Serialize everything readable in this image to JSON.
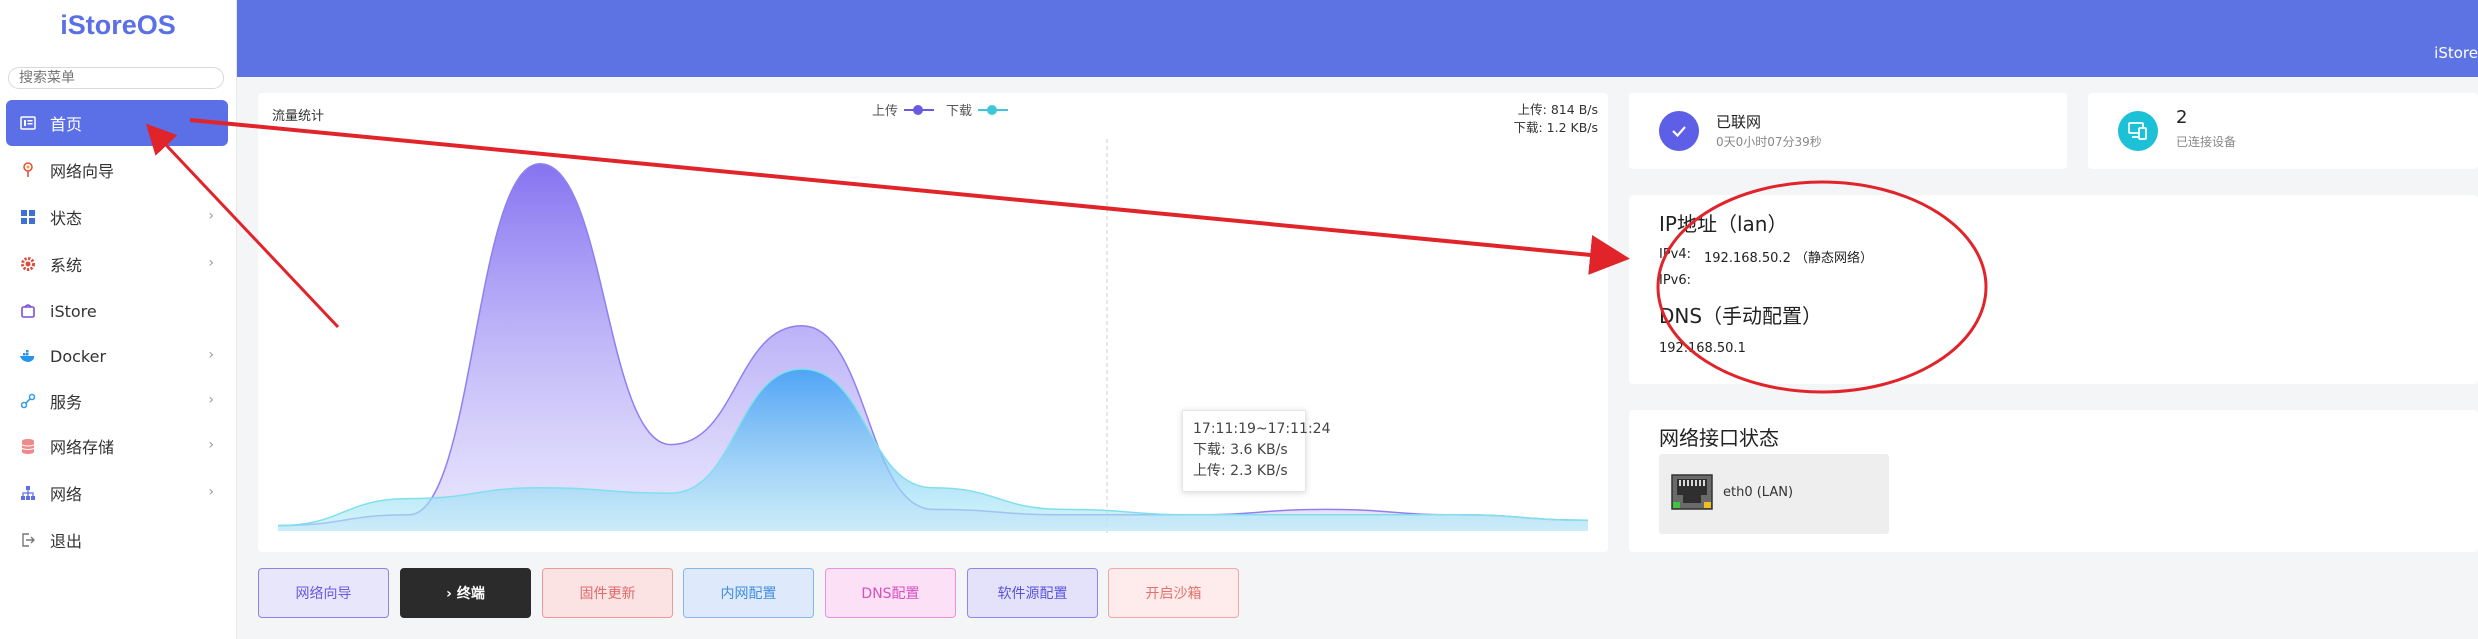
{
  "app": {
    "logo": "iStoreOS",
    "header_brand": "iStore"
  },
  "search": {
    "placeholder": "搜索菜单"
  },
  "menu": [
    {
      "label": "首页",
      "icon": "home-icon",
      "active": true
    },
    {
      "label": "网络向导",
      "icon": "wizard-icon"
    },
    {
      "label": "状态",
      "icon": "status-icon",
      "chevron": true
    },
    {
      "label": "系统",
      "icon": "gear-icon",
      "chevron": true
    },
    {
      "label": "iStore",
      "icon": "store-icon"
    },
    {
      "label": "Docker",
      "icon": "docker-icon",
      "chevron": true
    },
    {
      "label": "服务",
      "icon": "services-icon",
      "chevron": true
    },
    {
      "label": "网络存储",
      "icon": "storage-icon",
      "chevron": true
    },
    {
      "label": "网络",
      "icon": "network-icon",
      "chevron": true
    },
    {
      "label": "退出",
      "icon": "logout-icon"
    }
  ],
  "traffic": {
    "title": "流量统计",
    "legend": [
      {
        "label": "上传",
        "color": "#6a5ae0"
      },
      {
        "label": "下载",
        "color": "#3fc6dc"
      }
    ],
    "upload_rate": "上传: 814 B/s",
    "download_rate": "下载: 1.2 KB/s",
    "tooltip": {
      "time": "17:11:19~17:11:24",
      "download": "下载: 3.6 KB/s",
      "upload": "上传: 2.3 KB/s"
    }
  },
  "chart_data": {
    "type": "area",
    "title": "流量统计",
    "series": [
      {
        "name": "上传",
        "values": [
          0.1,
          0.3,
          6.8,
          1.6,
          3.8,
          0.4,
          0.3,
          0.3,
          0.4,
          0.3,
          0.2
        ]
      },
      {
        "name": "下载",
        "values": [
          0.1,
          0.6,
          0.8,
          0.7,
          3.0,
          0.8,
          0.4,
          0.3,
          0.3,
          0.3,
          0.2
        ]
      }
    ],
    "grid": false,
    "legend": "top-center"
  },
  "status": {
    "title": "已联网",
    "subtitle": "0天0小时07分39秒"
  },
  "devices": {
    "count": "2",
    "label": "已连接设备"
  },
  "ip": {
    "title": "IP地址（lan）",
    "ipv4_label": "IPv4:",
    "ipv4_value": "192.168.50.2 （静态网络）",
    "ipv6_label": "IPv6:",
    "dns_title": "DNS（手动配置）",
    "dns_value": "192.168.50.1"
  },
  "interfaces": {
    "title": "网络接口状态",
    "items": [
      {
        "name": "eth0 (LAN)"
      }
    ]
  },
  "quick_buttons": [
    {
      "label": "网络向导",
      "color": "#6a5ae0",
      "bg": "#e8e6fb",
      "border": "#8f82ea"
    },
    {
      "label": "› 终端",
      "color": "#ffffff",
      "bg": "#2b2b2b",
      "border": "#2b2b2b"
    },
    {
      "label": "固件更新",
      "color": "#e26a6a",
      "bg": "#fbe3e3",
      "border": "#ef9a9a"
    },
    {
      "label": "内网配置",
      "color": "#3f8ee0",
      "bg": "#deeafb",
      "border": "#86b6ee"
    },
    {
      "label": "DNS配置",
      "color": "#d84fc0",
      "bg": "#fbe0f6",
      "border": "#ee90dd"
    },
    {
      "label": "软件源配置",
      "color": "#5b52d8",
      "bg": "#e4e2fb",
      "border": "#8e86ea"
    },
    {
      "label": "开启沙箱",
      "color": "#e8706a",
      "bg": "#fdeceb",
      "border": "#f2a8a4"
    }
  ]
}
